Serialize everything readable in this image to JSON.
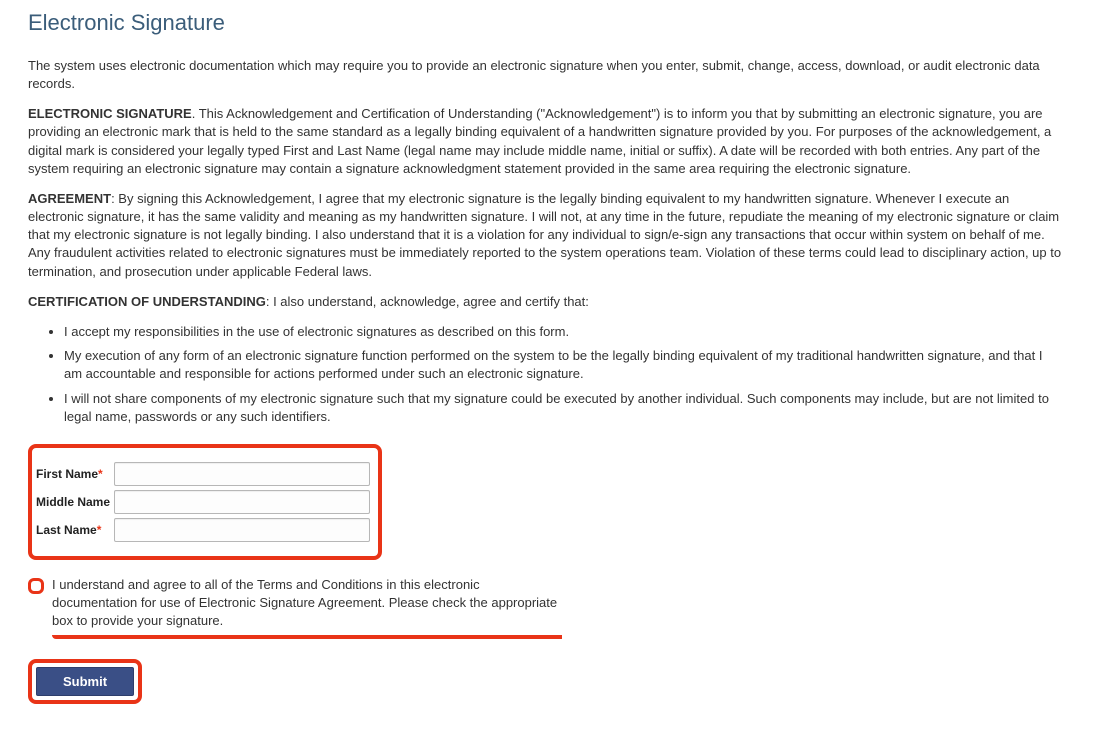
{
  "heading": "Electronic Signature",
  "intro": "The system uses electronic documentation which may require you to provide an electronic signature when you enter, submit, change, access, download, or audit electronic data records.",
  "section_esig": {
    "label": "ELECTRONIC SIGNATURE",
    "body": ". This Acknowledgement and Certification of Understanding (\"Acknowledgement\") is to inform you that by submitting an electronic signature, you are providing an electronic mark that is held to the same standard as a legally binding equivalent of a handwritten signature provided by you. For purposes of the acknowledgement, a digital mark is considered your legally typed First and Last Name (legal name may include middle name, initial or suffix). A date will be recorded with both entries. Any part of the system requiring an electronic signature may contain a signature acknowledgment statement provided in the same area requiring the electronic signature."
  },
  "section_agreement": {
    "label": "AGREEMENT",
    "body": ": By signing this Acknowledgement, I agree that my electronic signature is the legally binding equivalent to my handwritten signature. Whenever I execute an electronic signature, it has the same validity and meaning as my handwritten signature. I will not, at any time in the future, repudiate the meaning of my electronic signature or claim that my electronic signature is not legally binding. I also understand that it is a violation for any individual to sign/e-sign any transactions that occur within system on behalf of me. Any fraudulent activities related to electronic signatures must be immediately reported to the system operations team. Violation of these terms could lead to disciplinary action, up to termination, and prosecution under applicable Federal laws."
  },
  "section_cert": {
    "label": "CERTIFICATION OF UNDERSTANDING",
    "body": ": I also understand, acknowledge, agree and certify that:"
  },
  "bullets": [
    "I accept my responsibilities in the use of electronic signatures as described on this form.",
    "My execution of any form of an electronic signature function performed on the system to be the legally binding equivalent of my traditional handwritten signature, and that I am accountable and responsible for actions performed under such an electronic signature.",
    "I will not share components of my electronic signature such that my signature could be executed by another individual. Such components may include, but are not limited to legal name, passwords or any such identifiers."
  ],
  "form": {
    "first_name_label": "First Name",
    "middle_name_label": "Middle Name",
    "last_name_label": "Last Name",
    "required_mark": "*",
    "first_name_value": "",
    "middle_name_value": "",
    "last_name_value": ""
  },
  "agree_text": "I understand and agree to all of the Terms and Conditions in this electronic documentation for use of Electronic Signature Agreement. Please check the appropriate box to provide your signature.",
  "submit_label": "Submit"
}
